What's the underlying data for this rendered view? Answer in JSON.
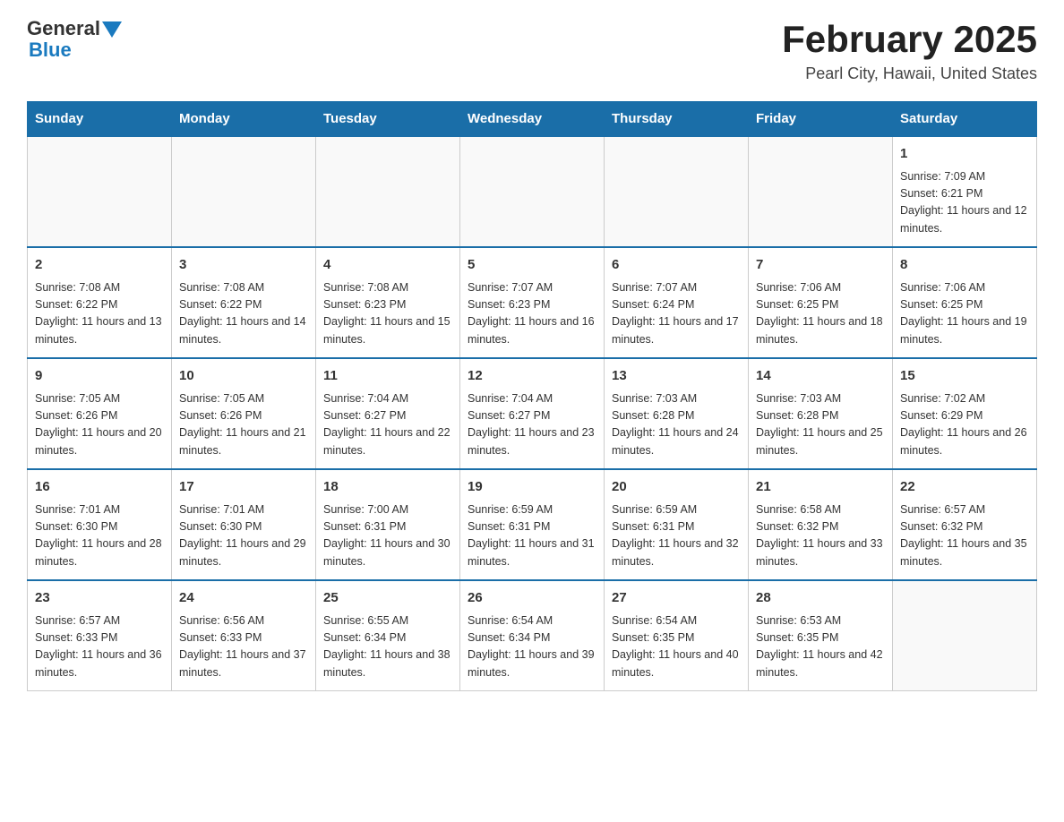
{
  "header": {
    "logo_general": "General",
    "logo_blue": "Blue",
    "month_title": "February 2025",
    "location": "Pearl City, Hawaii, United States"
  },
  "days_of_week": [
    "Sunday",
    "Monday",
    "Tuesday",
    "Wednesday",
    "Thursday",
    "Friday",
    "Saturday"
  ],
  "weeks": [
    [
      {
        "day": "",
        "info": ""
      },
      {
        "day": "",
        "info": ""
      },
      {
        "day": "",
        "info": ""
      },
      {
        "day": "",
        "info": ""
      },
      {
        "day": "",
        "info": ""
      },
      {
        "day": "",
        "info": ""
      },
      {
        "day": "1",
        "info": "Sunrise: 7:09 AM\nSunset: 6:21 PM\nDaylight: 11 hours and 12 minutes."
      }
    ],
    [
      {
        "day": "2",
        "info": "Sunrise: 7:08 AM\nSunset: 6:22 PM\nDaylight: 11 hours and 13 minutes."
      },
      {
        "day": "3",
        "info": "Sunrise: 7:08 AM\nSunset: 6:22 PM\nDaylight: 11 hours and 14 minutes."
      },
      {
        "day": "4",
        "info": "Sunrise: 7:08 AM\nSunset: 6:23 PM\nDaylight: 11 hours and 15 minutes."
      },
      {
        "day": "5",
        "info": "Sunrise: 7:07 AM\nSunset: 6:23 PM\nDaylight: 11 hours and 16 minutes."
      },
      {
        "day": "6",
        "info": "Sunrise: 7:07 AM\nSunset: 6:24 PM\nDaylight: 11 hours and 17 minutes."
      },
      {
        "day": "7",
        "info": "Sunrise: 7:06 AM\nSunset: 6:25 PM\nDaylight: 11 hours and 18 minutes."
      },
      {
        "day": "8",
        "info": "Sunrise: 7:06 AM\nSunset: 6:25 PM\nDaylight: 11 hours and 19 minutes."
      }
    ],
    [
      {
        "day": "9",
        "info": "Sunrise: 7:05 AM\nSunset: 6:26 PM\nDaylight: 11 hours and 20 minutes."
      },
      {
        "day": "10",
        "info": "Sunrise: 7:05 AM\nSunset: 6:26 PM\nDaylight: 11 hours and 21 minutes."
      },
      {
        "day": "11",
        "info": "Sunrise: 7:04 AM\nSunset: 6:27 PM\nDaylight: 11 hours and 22 minutes."
      },
      {
        "day": "12",
        "info": "Sunrise: 7:04 AM\nSunset: 6:27 PM\nDaylight: 11 hours and 23 minutes."
      },
      {
        "day": "13",
        "info": "Sunrise: 7:03 AM\nSunset: 6:28 PM\nDaylight: 11 hours and 24 minutes."
      },
      {
        "day": "14",
        "info": "Sunrise: 7:03 AM\nSunset: 6:28 PM\nDaylight: 11 hours and 25 minutes."
      },
      {
        "day": "15",
        "info": "Sunrise: 7:02 AM\nSunset: 6:29 PM\nDaylight: 11 hours and 26 minutes."
      }
    ],
    [
      {
        "day": "16",
        "info": "Sunrise: 7:01 AM\nSunset: 6:30 PM\nDaylight: 11 hours and 28 minutes."
      },
      {
        "day": "17",
        "info": "Sunrise: 7:01 AM\nSunset: 6:30 PM\nDaylight: 11 hours and 29 minutes."
      },
      {
        "day": "18",
        "info": "Sunrise: 7:00 AM\nSunset: 6:31 PM\nDaylight: 11 hours and 30 minutes."
      },
      {
        "day": "19",
        "info": "Sunrise: 6:59 AM\nSunset: 6:31 PM\nDaylight: 11 hours and 31 minutes."
      },
      {
        "day": "20",
        "info": "Sunrise: 6:59 AM\nSunset: 6:31 PM\nDaylight: 11 hours and 32 minutes."
      },
      {
        "day": "21",
        "info": "Sunrise: 6:58 AM\nSunset: 6:32 PM\nDaylight: 11 hours and 33 minutes."
      },
      {
        "day": "22",
        "info": "Sunrise: 6:57 AM\nSunset: 6:32 PM\nDaylight: 11 hours and 35 minutes."
      }
    ],
    [
      {
        "day": "23",
        "info": "Sunrise: 6:57 AM\nSunset: 6:33 PM\nDaylight: 11 hours and 36 minutes."
      },
      {
        "day": "24",
        "info": "Sunrise: 6:56 AM\nSunset: 6:33 PM\nDaylight: 11 hours and 37 minutes."
      },
      {
        "day": "25",
        "info": "Sunrise: 6:55 AM\nSunset: 6:34 PM\nDaylight: 11 hours and 38 minutes."
      },
      {
        "day": "26",
        "info": "Sunrise: 6:54 AM\nSunset: 6:34 PM\nDaylight: 11 hours and 39 minutes."
      },
      {
        "day": "27",
        "info": "Sunrise: 6:54 AM\nSunset: 6:35 PM\nDaylight: 11 hours and 40 minutes."
      },
      {
        "day": "28",
        "info": "Sunrise: 6:53 AM\nSunset: 6:35 PM\nDaylight: 11 hours and 42 minutes."
      },
      {
        "day": "",
        "info": ""
      }
    ]
  ]
}
